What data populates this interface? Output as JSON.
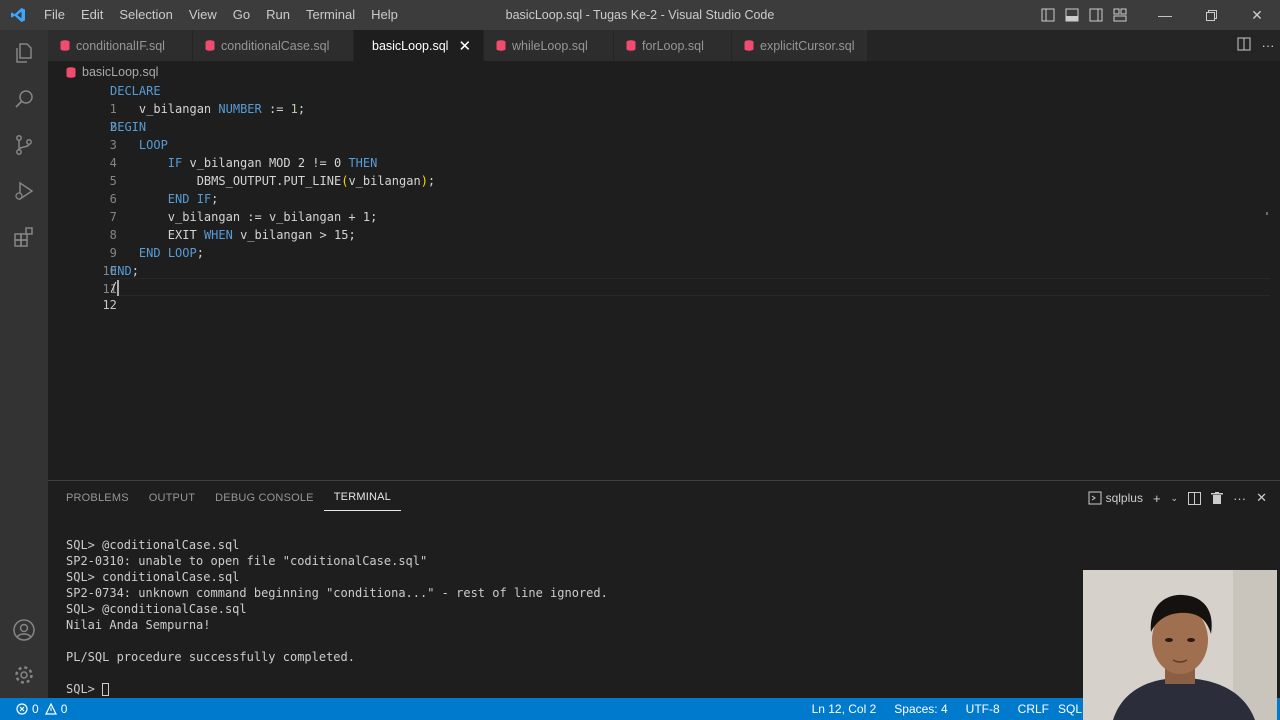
{
  "window": {
    "title": "basicLoop.sql - Tugas Ke-2 - Visual Studio Code",
    "menu": [
      "File",
      "Edit",
      "Selection",
      "View",
      "Go",
      "Run",
      "Terminal",
      "Help"
    ]
  },
  "tabs": [
    {
      "label": "conditionalIF.sql",
      "active": false
    },
    {
      "label": "conditionalCase.sql",
      "active": false
    },
    {
      "label": "basicLoop.sql",
      "active": true
    },
    {
      "label": "whileLoop.sql",
      "active": false
    },
    {
      "label": "forLoop.sql",
      "active": false
    },
    {
      "label": "explicitCursor.sql",
      "active": false
    }
  ],
  "breadcrumb": {
    "file": "basicLoop.sql"
  },
  "editor": {
    "line_numbers": [
      "1",
      "2",
      "3",
      "4",
      "5",
      "6",
      "7",
      "8",
      "9",
      "10",
      "11",
      "12"
    ],
    "current_line": 12,
    "code": {
      "l1": "DECLARE",
      "l2_var": "v_bilangan",
      "l2_type": "NUMBER",
      "l2_op": ":=",
      "l2_num": "1",
      "l2_end": ";",
      "l3": "BEGIN",
      "l4": "LOOP",
      "l5_if": "IF",
      "l5_expr": "v_bilangan MOD 2 != 0",
      "l5_then": "THEN",
      "l6_fn": "DBMS_OUTPUT.PUT_LINE",
      "l6_open": "(",
      "l6_arg": "v_bilangan",
      "l6_close": ")",
      "l6_end": ";",
      "l7_end": "END",
      "l7_if": "IF",
      "l7_semi": ";",
      "l8": "v_bilangan := v_bilangan + 1;",
      "l9_exit": "EXIT",
      "l9_when": "WHEN",
      "l9_rest": "v_bilangan > 15;",
      "l10_end": "END",
      "l10_loop": "LOOP",
      "l10_semi": ";",
      "l11_end": "END",
      "l11_semi": ";",
      "l12": "/"
    }
  },
  "panel": {
    "tabs": [
      "PROBLEMS",
      "OUTPUT",
      "DEBUG CONSOLE",
      "TERMINAL"
    ],
    "active_tab": "TERMINAL",
    "terminal_name": "sqlplus",
    "terminal_lines": [
      "SQL> @coditionalCase.sql",
      "SP2-0310: unable to open file \"coditionalCase.sql\"",
      "SQL> conditionalCase.sql",
      "SP2-0734: unknown command beginning \"conditiona...\" - rest of line ignored.",
      "SQL> @conditionalCase.sql",
      "Nilai Anda Sempurna!",
      "",
      "PL/SQL procedure successfully completed.",
      ""
    ],
    "prompt": "SQL> "
  },
  "status": {
    "errors": "0",
    "warnings": "0",
    "position": "Ln 12, Col 2",
    "spaces": "Spaces: 4",
    "encoding": "UTF-8",
    "eol": "CRLF",
    "language": "SQL"
  },
  "colors": {
    "status_bar": "#007acc",
    "activity_bar": "#333333",
    "editor_bg": "#1e1e1e",
    "keyword": "#569cd6",
    "sql_file_icon": "#f14c6f"
  }
}
